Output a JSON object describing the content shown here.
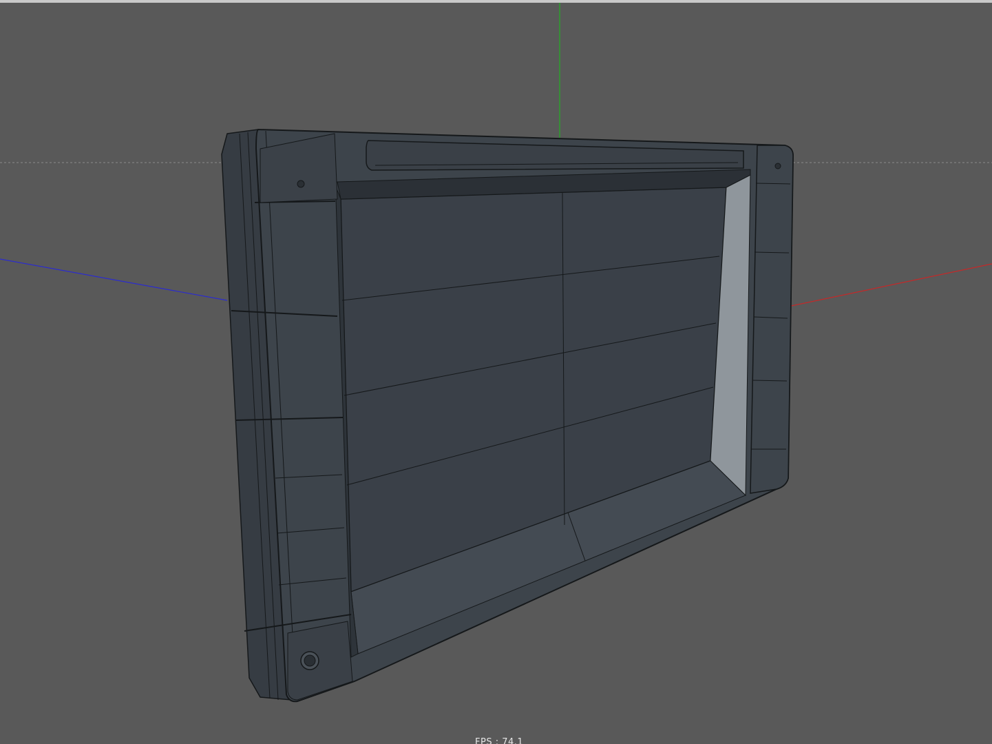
{
  "viewport": {
    "background_color": "#595959",
    "fps_text": "FPS : 74.1"
  },
  "axes": {
    "x_axis_color": "#c62828",
    "y_axis_color": "#2e9e2e",
    "z_axis_color": "#2b2bd0"
  },
  "model": {
    "description_icon": "frame-mesh-icon",
    "shell_color": "#3d444b",
    "panel_color": "#3a4048",
    "bevel_color": "#8f969c",
    "wire_color": "#15181a"
  }
}
